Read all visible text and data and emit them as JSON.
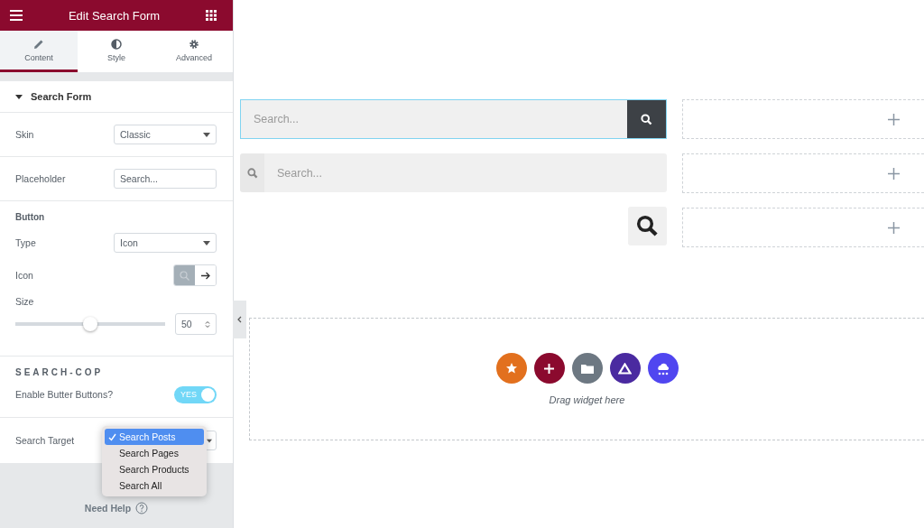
{
  "header": {
    "title": "Edit Search Form"
  },
  "tabs": [
    {
      "label": "Content",
      "kind": "pencil",
      "selected": true
    },
    {
      "label": "Style",
      "kind": "contrast",
      "selected": false
    },
    {
      "label": "Advanced",
      "kind": "gear",
      "selected": false
    }
  ],
  "section": {
    "title": "Search Form",
    "expanded": true
  },
  "skin": {
    "label": "Skin",
    "value": "Classic"
  },
  "placeholder_field": {
    "label": "Placeholder",
    "value": "Search..."
  },
  "button_section": {
    "title": "Button",
    "type": {
      "label": "Type",
      "value": "Icon"
    },
    "icon": {
      "label": "Icon",
      "options": [
        {
          "kind": "search",
          "selected": true
        },
        {
          "kind": "arrow",
          "selected": false
        }
      ]
    },
    "size": {
      "label": "Size",
      "level": 0.5,
      "value": "50"
    }
  },
  "search_cop": {
    "title": "SEARCH-COP",
    "toggle": {
      "label": "Enable Butter Buttons?",
      "on": true,
      "on_text": "YES"
    },
    "target": {
      "label": "Search Target",
      "expanded": true,
      "options": [
        {
          "label": "Search Posts",
          "selected": true
        },
        {
          "label": "Search Pages",
          "selected": false
        },
        {
          "label": "Search Products",
          "selected": false
        },
        {
          "label": "Search All",
          "selected": false
        }
      ]
    }
  },
  "help": {
    "label": "Need Help"
  },
  "widgets": [
    {
      "kind": "classic",
      "placeholder": "Search..."
    },
    {
      "kind": "minimal",
      "placeholder": "Search..."
    },
    {
      "kind": "full_screen"
    }
  ],
  "drop_zone": {
    "buttons": [
      {
        "kind": "star",
        "color": "#e2701e"
      },
      {
        "kind": "plus",
        "color": "#8b0a2e"
      },
      {
        "kind": "folder",
        "color": "#6d7882"
      },
      {
        "kind": "triangle",
        "color": "#4a2aa0"
      },
      {
        "kind": "cloud",
        "color": "#5046f0"
      }
    ],
    "hint": "Drag widget here"
  }
}
